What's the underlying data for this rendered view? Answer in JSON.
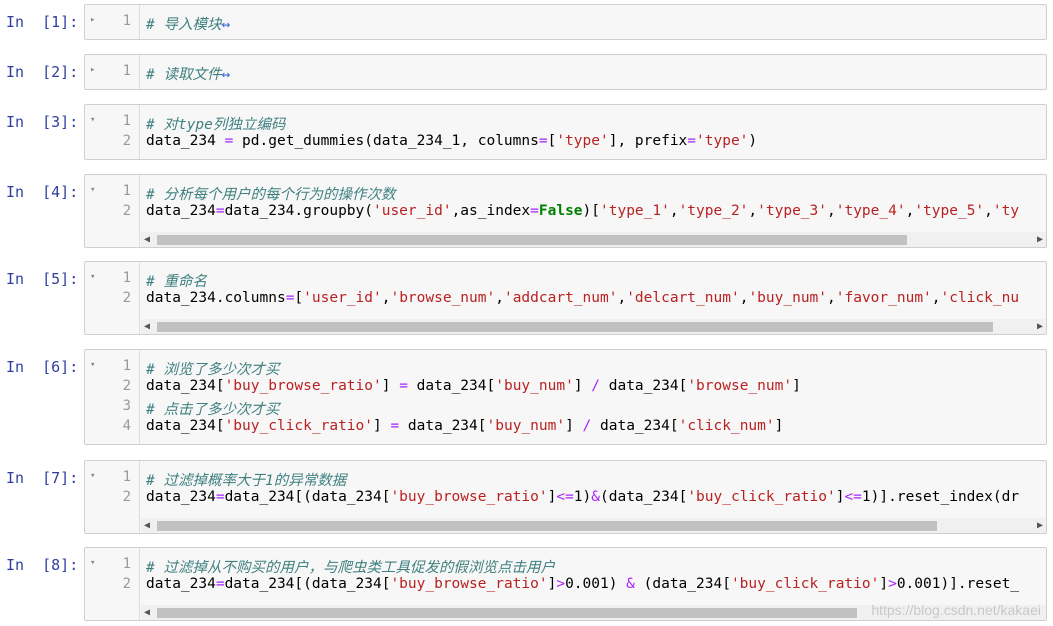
{
  "cells": [
    {
      "prompt": "In  [1]:",
      "lines": [
        "1"
      ],
      "code": [
        [
          {
            "t": "# 导入模块",
            "c": "cm"
          },
          {
            "t": "↔",
            "c": "hl"
          }
        ]
      ]
    },
    {
      "prompt": "In  [2]:",
      "lines": [
        "1"
      ],
      "code": [
        [
          {
            "t": "# 读取文件",
            "c": "cm"
          },
          {
            "t": "↔",
            "c": "hl"
          }
        ]
      ]
    },
    {
      "prompt": "In  [3]:",
      "lines": [
        "1",
        "2"
      ],
      "code": [
        [
          {
            "t": "# 对type列独立编码",
            "c": "cm"
          }
        ],
        [
          {
            "t": "data_234 ",
            "c": ""
          },
          {
            "t": "=",
            "c": "op"
          },
          {
            "t": " pd.get_dummies(data_234_1, columns",
            "c": ""
          },
          {
            "t": "=",
            "c": "op"
          },
          {
            "t": "[",
            "c": ""
          },
          {
            "t": "'type'",
            "c": "str"
          },
          {
            "t": "], prefix",
            "c": ""
          },
          {
            "t": "=",
            "c": "op"
          },
          {
            "t": "'type'",
            "c": "str"
          },
          {
            "t": ")",
            "c": ""
          }
        ]
      ]
    },
    {
      "prompt": "In  [4]:",
      "lines": [
        "1",
        "2"
      ],
      "code": [
        [
          {
            "t": "# 分析每个用户的每个行为的操作次数",
            "c": "cm"
          }
        ],
        [
          {
            "t": "data_234",
            "c": ""
          },
          {
            "t": "=",
            "c": "op"
          },
          {
            "t": "data_234.groupby(",
            "c": ""
          },
          {
            "t": "'user_id'",
            "c": "str"
          },
          {
            "t": ",as_index",
            "c": ""
          },
          {
            "t": "=",
            "c": "op"
          },
          {
            "t": "False",
            "c": "kw"
          },
          {
            "t": ")[",
            "c": ""
          },
          {
            "t": "'type_1'",
            "c": "str"
          },
          {
            "t": ",",
            "c": ""
          },
          {
            "t": "'type_2'",
            "c": "str"
          },
          {
            "t": ",",
            "c": ""
          },
          {
            "t": "'type_3'",
            "c": "str"
          },
          {
            "t": ",",
            "c": ""
          },
          {
            "t": "'type_4'",
            "c": "str"
          },
          {
            "t": ",",
            "c": ""
          },
          {
            "t": "'type_5'",
            "c": "str"
          },
          {
            "t": ",",
            "c": ""
          },
          {
            "t": "'ty",
            "c": "str"
          }
        ]
      ]
    },
    {
      "prompt": "In  [5]:",
      "lines": [
        "1",
        "2"
      ],
      "code": [
        [
          {
            "t": "# 重命名",
            "c": "cm"
          }
        ],
        [
          {
            "t": "data_234.columns",
            "c": ""
          },
          {
            "t": "=",
            "c": "op"
          },
          {
            "t": "[",
            "c": ""
          },
          {
            "t": "'user_id'",
            "c": "str"
          },
          {
            "t": ",",
            "c": ""
          },
          {
            "t": "'browse_num'",
            "c": "str"
          },
          {
            "t": ",",
            "c": ""
          },
          {
            "t": "'addcart_num'",
            "c": "str"
          },
          {
            "t": ",",
            "c": ""
          },
          {
            "t": "'delcart_num'",
            "c": "str"
          },
          {
            "t": ",",
            "c": ""
          },
          {
            "t": "'buy_num'",
            "c": "str"
          },
          {
            "t": ",",
            "c": ""
          },
          {
            "t": "'favor_num'",
            "c": "str"
          },
          {
            "t": ",",
            "c": ""
          },
          {
            "t": "'click_nu",
            "c": "str"
          }
        ]
      ]
    },
    {
      "prompt": "In  [6]:",
      "lines": [
        "1",
        "2",
        "3",
        "4"
      ],
      "code": [
        [
          {
            "t": "# 浏览了多少次才买",
            "c": "cm"
          }
        ],
        [
          {
            "t": "data_234[",
            "c": ""
          },
          {
            "t": "'buy_browse_ratio'",
            "c": "str"
          },
          {
            "t": "] ",
            "c": ""
          },
          {
            "t": "=",
            "c": "op"
          },
          {
            "t": " data_234[",
            "c": ""
          },
          {
            "t": "'buy_num'",
            "c": "str"
          },
          {
            "t": "] ",
            "c": ""
          },
          {
            "t": "/",
            "c": "op"
          },
          {
            "t": " data_234[",
            "c": ""
          },
          {
            "t": "'browse_num'",
            "c": "str"
          },
          {
            "t": "]",
            "c": ""
          }
        ],
        [
          {
            "t": "# 点击了多少次才买",
            "c": "cm"
          }
        ],
        [
          {
            "t": "data_234[",
            "c": ""
          },
          {
            "t": "'buy_click_ratio'",
            "c": "str"
          },
          {
            "t": "] ",
            "c": ""
          },
          {
            "t": "=",
            "c": "op"
          },
          {
            "t": " data_234[",
            "c": ""
          },
          {
            "t": "'buy_num'",
            "c": "str"
          },
          {
            "t": "] ",
            "c": ""
          },
          {
            "t": "/",
            "c": "op"
          },
          {
            "t": " data_234[",
            "c": ""
          },
          {
            "t": "'click_num'",
            "c": "str"
          },
          {
            "t": "]",
            "c": ""
          }
        ]
      ]
    },
    {
      "prompt": "In  [7]:",
      "lines": [
        "1",
        "2"
      ],
      "code": [
        [
          {
            "t": "# 过滤掉概率大于1的异常数据",
            "c": "cm"
          }
        ],
        [
          {
            "t": "data_234",
            "c": ""
          },
          {
            "t": "=",
            "c": "op"
          },
          {
            "t": "data_234[(data_234[",
            "c": ""
          },
          {
            "t": "'buy_browse_ratio'",
            "c": "str"
          },
          {
            "t": "]",
            "c": ""
          },
          {
            "t": "<=",
            "c": "op"
          },
          {
            "t": "1)",
            "c": ""
          },
          {
            "t": "&",
            "c": "op"
          },
          {
            "t": "(data_234[",
            "c": ""
          },
          {
            "t": "'buy_click_ratio'",
            "c": "str"
          },
          {
            "t": "]",
            "c": ""
          },
          {
            "t": "<=",
            "c": "op"
          },
          {
            "t": "1)].reset_index(dr",
            "c": ""
          }
        ]
      ]
    },
    {
      "prompt": "In  [8]:",
      "lines": [
        "1",
        "2"
      ],
      "code": [
        [
          {
            "t": "# 过滤掉从不购买的用户，与爬虫类工具促发的假浏览点击用户",
            "c": "cm"
          }
        ],
        [
          {
            "t": "data_234",
            "c": ""
          },
          {
            "t": "=",
            "c": "op"
          },
          {
            "t": "data_234[(data_234[",
            "c": ""
          },
          {
            "t": "'buy_browse_ratio'",
            "c": "str"
          },
          {
            "t": "]",
            "c": ""
          },
          {
            "t": ">",
            "c": "op"
          },
          {
            "t": "0.001) ",
            "c": ""
          },
          {
            "t": "&",
            "c": "op"
          },
          {
            "t": " (data_234[",
            "c": ""
          },
          {
            "t": "'buy_click_ratio'",
            "c": "str"
          },
          {
            "t": "]",
            "c": ""
          },
          {
            "t": ">",
            "c": "op"
          },
          {
            "t": "0.001)].reset_",
            "c": ""
          }
        ]
      ]
    }
  ],
  "watermark": "https://blog.csdn.net/kakaei"
}
